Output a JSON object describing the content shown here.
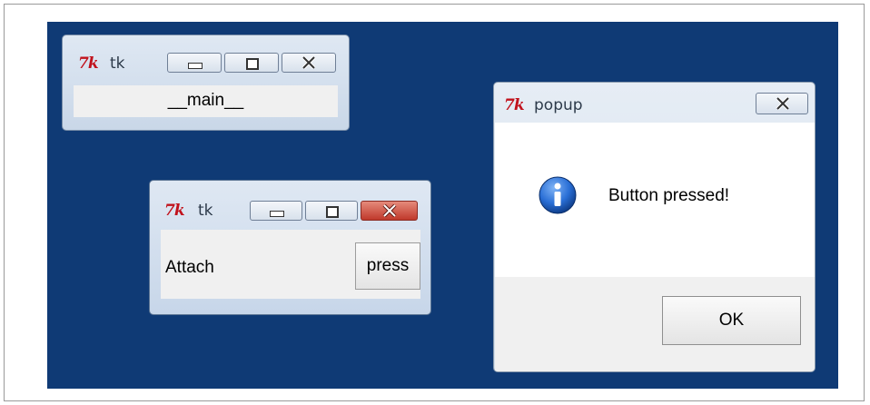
{
  "desktop": {
    "background_color": "#0f3a75"
  },
  "windows": {
    "main": {
      "title": "tk",
      "logo_text": "7k",
      "label": "__main__",
      "caption_buttons": [
        "minimize",
        "maximize",
        "close"
      ]
    },
    "attach": {
      "title": "tk",
      "logo_text": "7k",
      "label": "Attach",
      "button_label": "press",
      "caption_buttons": [
        "minimize",
        "maximize",
        "close"
      ]
    },
    "popup": {
      "title": "popup",
      "logo_text": "7k",
      "message": "Button pressed!",
      "icon": "info-icon",
      "ok_label": "OK"
    }
  }
}
